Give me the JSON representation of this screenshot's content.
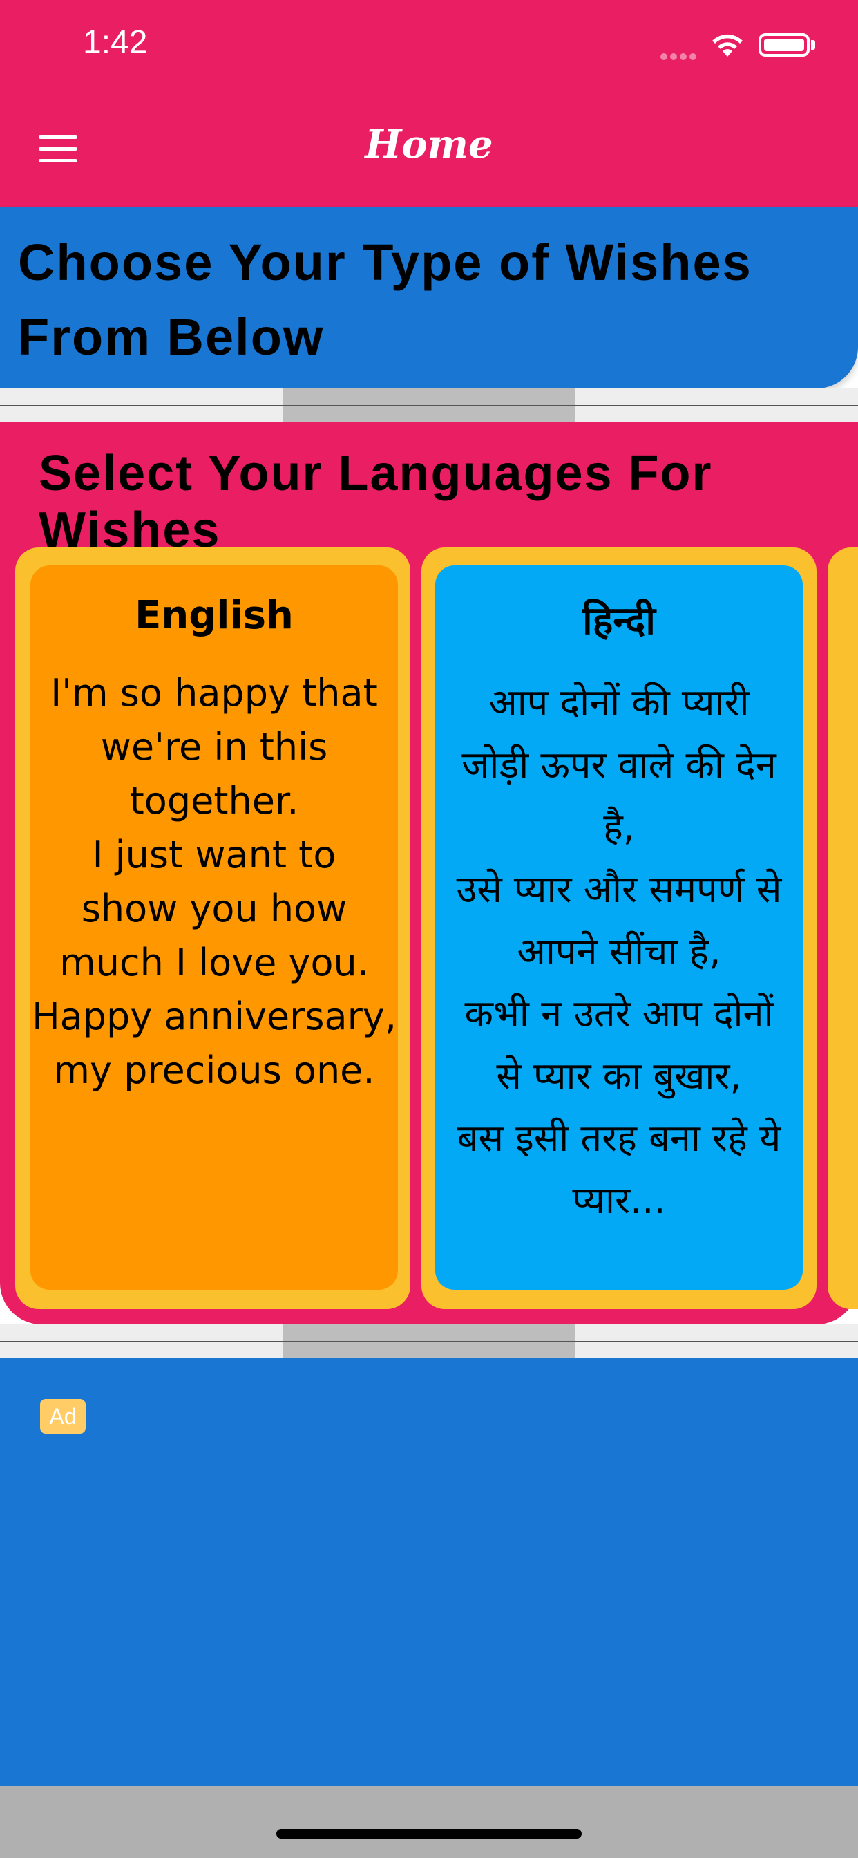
{
  "status_bar": {
    "time": "1:42"
  },
  "nav": {
    "title": "Home"
  },
  "header": {
    "text": "Choose Your Type of Wishes From Below"
  },
  "languages": {
    "title": "Select Your Languages For Wishes",
    "cards": [
      {
        "title": "English",
        "body": "I'm so happy that\nwe're in this\ntogether.\n I just want to\nshow you how\nmuch I love you.\nHappy anniversary,\nmy precious one."
      },
      {
        "title": "हिन्दी",
        "body": "आप दोनों की प्यारी\nजोड़ी ऊपर वाले की देन\nहै,\nउसे प्यार और समपर्ण से\nआपने सींचा है,\nकभी न उतरे आप दोनों\nसे प्यार का बुखार,\nबस इसी तरह बना रहे ये\nप्यार..."
      }
    ]
  },
  "ad": {
    "badge": "Ad"
  },
  "colors": {
    "primary": "#E91E63",
    "header_blue": "#1976D2",
    "card_border": "#FBC02D",
    "english_card": "#FF9800",
    "hindi_card": "#03A9F4"
  }
}
